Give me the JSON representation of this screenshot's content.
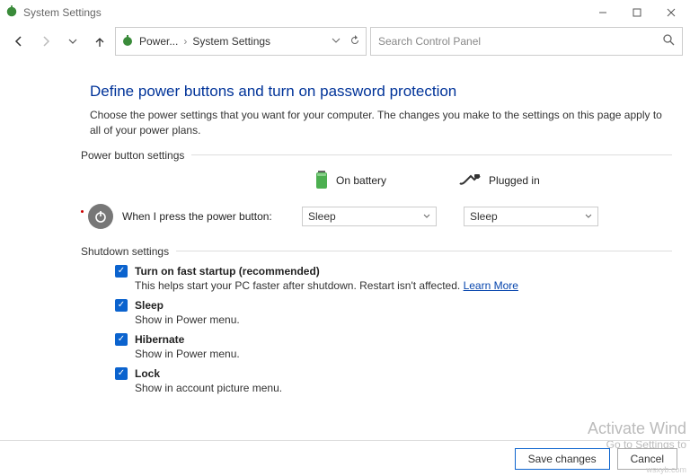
{
  "window": {
    "title": "System Settings"
  },
  "address": {
    "crumb1": "Power...",
    "crumb2": "System Settings"
  },
  "search": {
    "placeholder": "Search Control Panel"
  },
  "heading": "Define power buttons and turn on password protection",
  "desc": "Choose the power settings that you want for your computer. The changes you make to the settings on this page apply to all of your power plans.",
  "section1": "Power button settings",
  "col_battery": "On battery",
  "col_plugged": "Plugged in",
  "row_label": "When I press the power button:",
  "sel_battery": "Sleep",
  "sel_plugged": "Sleep",
  "section2": "Shutdown settings",
  "s1": {
    "title": "Turn on fast startup (recommended)",
    "sub": "This helps start your PC faster after shutdown. Restart isn't affected.",
    "learn": "Learn More"
  },
  "s2": {
    "title": "Sleep",
    "sub": "Show in Power menu."
  },
  "s3": {
    "title": "Hibernate",
    "sub": "Show in Power menu."
  },
  "s4": {
    "title": "Lock",
    "sub": "Show in account picture menu."
  },
  "footer": {
    "save": "Save changes",
    "cancel": "Cancel"
  },
  "watermark": {
    "l1": "Activate Wind",
    "l2": "Go to Settings to"
  },
  "corner": "wsxyb.com"
}
